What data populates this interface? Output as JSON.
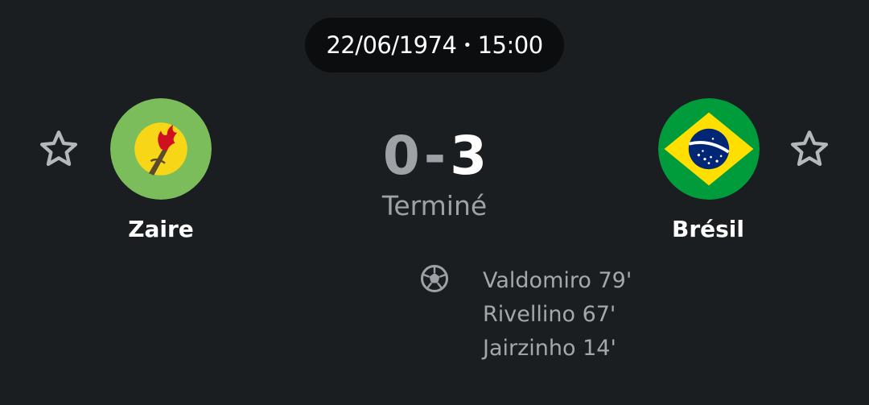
{
  "match": {
    "date": "22/06/1974",
    "separator": "•",
    "time": "15:00",
    "status": "Terminé"
  },
  "home": {
    "name": "Zaire",
    "score": "0",
    "flag_icon": "zaire-flag-icon",
    "flag_colors": {
      "field": "#7bbd5a",
      "disc": "#f7d618",
      "flame": "#ce1021"
    }
  },
  "away": {
    "name": "Brésil",
    "score": "3",
    "flag_icon": "brazil-flag-icon",
    "flag_colors": {
      "field": "#009b3a",
      "diamond": "#fedf00",
      "globe": "#002776"
    }
  },
  "score_separator": "-",
  "scorers": {
    "icon": "soccer-ball-icon",
    "away": [
      {
        "text": "Valdomiro 79'"
      },
      {
        "text": "Rivellino 67'"
      },
      {
        "text": "Jairzinho 14'"
      }
    ]
  },
  "colors": {
    "background": "#1b1e21",
    "pill": "#0b0d0e",
    "muted_text": "#9ea1a5",
    "star_outline": "#b4b7bb"
  }
}
